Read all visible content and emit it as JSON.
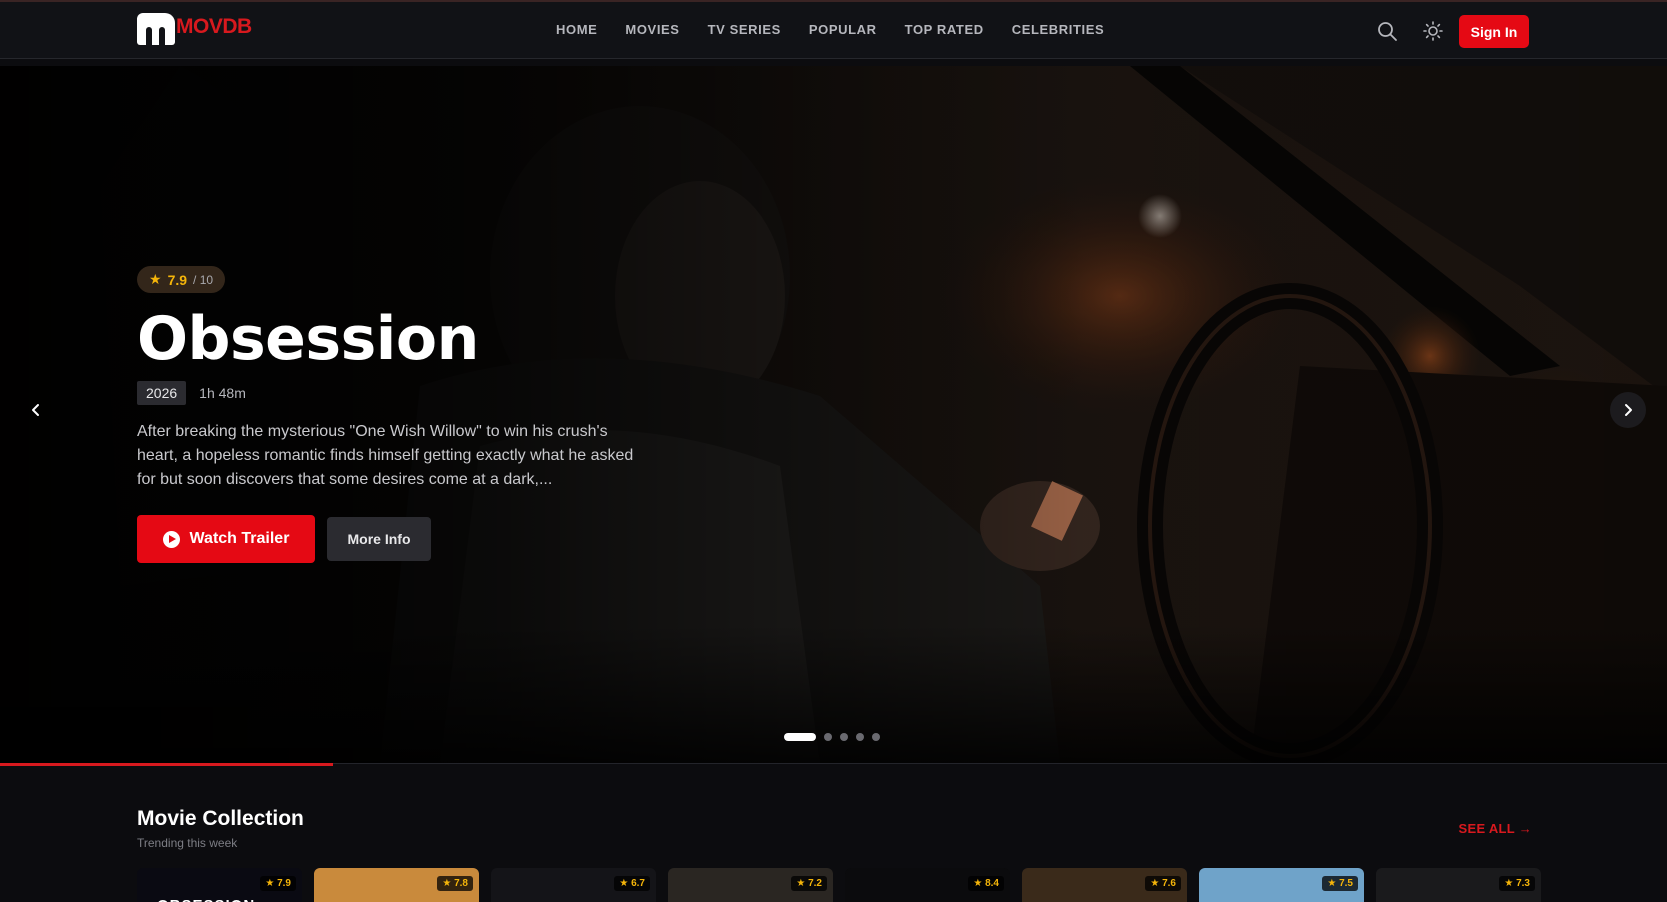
{
  "brand": {
    "logo_text": "MOVDB",
    "accent": "#e50914"
  },
  "nav": {
    "links": [
      "HOME",
      "MOVIES",
      "TV SERIES",
      "POPULAR",
      "TOP RATED",
      "CELEBRITIES"
    ],
    "search_icon": "search-icon",
    "theme_icon": "sun-icon",
    "sign_in_label": "Sign In"
  },
  "hero": {
    "rating": "7.9",
    "rating_max": "/ 10",
    "title": "Obsession",
    "year": "2026",
    "runtime": "1h 48m",
    "description": "After breaking the mysterious \"One Wish Willow\" to win his crush's heart, a hopeless romantic finds himself getting exactly what he asked for but soon discovers that some desires come at a dark,...",
    "watch_label": "Watch Trailer",
    "more_label": "More Info",
    "slide_count": 5,
    "active_slide": 1,
    "progress_fraction": 0.2
  },
  "collection": {
    "title": "Movie Collection",
    "subtitle": "Trending this week",
    "see_all": "SEE ALL →",
    "cards": [
      {
        "rating": "★ 7.9",
        "title_text": "OBSESSION",
        "bg": "#0a0a12"
      },
      {
        "rating": "★ 7.8",
        "title_text": "",
        "bg": "#c98a3c"
      },
      {
        "rating": "★ 6.7",
        "title_text": "",
        "bg": "#141418"
      },
      {
        "rating": "★ 7.2",
        "title_text": "",
        "bg": "#2a2622"
      },
      {
        "rating": "★ 8.4",
        "title_text": "",
        "bg": "#0b0b0d"
      },
      {
        "rating": "★ 7.6",
        "title_text": "",
        "bg": "#3a2a1a"
      },
      {
        "rating": "★ 7.5",
        "title_text": "",
        "bg": "#6fa3c9"
      },
      {
        "rating": "★ 7.3",
        "title_text": "",
        "bg": "#1a1a1c"
      }
    ]
  }
}
